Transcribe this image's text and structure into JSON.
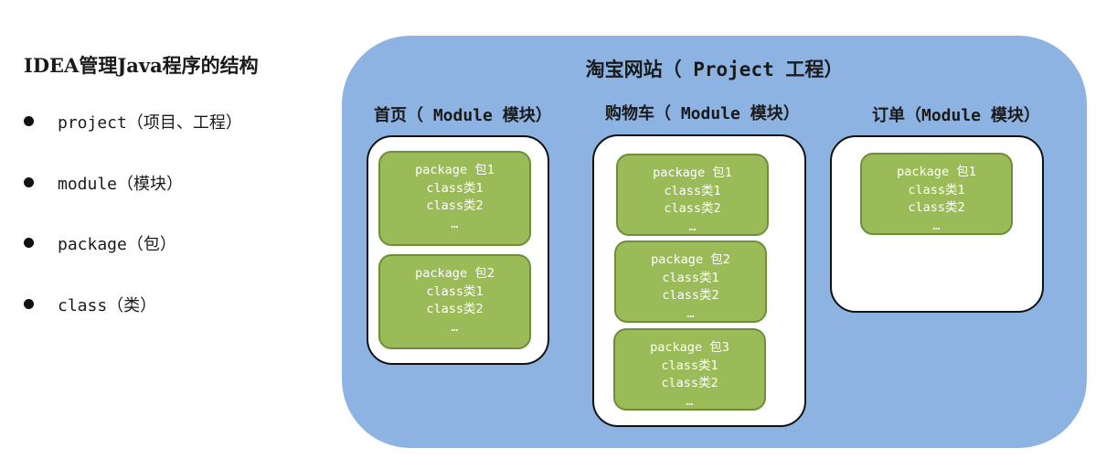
{
  "left": {
    "title": "IDEA管理Java程序的结构",
    "items": [
      {
        "label": "project（项目、工程）"
      },
      {
        "label": "module（模块）"
      },
      {
        "label": "package（包）"
      },
      {
        "label": "class（类）"
      }
    ]
  },
  "diagram": {
    "project_title": "淘宝网站（ Project 工程）",
    "modules": [
      {
        "title": "首页（ Module 模块）",
        "packages": [
          {
            "name": "package 包1",
            "classes": [
              "class类1",
              "class类2"
            ],
            "more": "…"
          },
          {
            "name": "package 包2",
            "classes": [
              "class类1",
              "class类2"
            ],
            "more": "…"
          }
        ]
      },
      {
        "title": "购物车（ Module 模块）",
        "packages": [
          {
            "name": "package 包1",
            "classes": [
              "class类1",
              "class类2"
            ],
            "more": "…"
          },
          {
            "name": "package 包2",
            "classes": [
              "class类1",
              "class类2"
            ],
            "more": "…"
          },
          {
            "name": "package 包3",
            "classes": [
              "class类1",
              "class类2"
            ],
            "more": "…"
          }
        ]
      },
      {
        "title": "订单（Module 模块）",
        "packages": [
          {
            "name": "package 包1",
            "classes": [
              "class类1",
              "class类2"
            ],
            "more": "…"
          }
        ]
      }
    ]
  },
  "colors": {
    "project_fill": "#8db3e2",
    "package_fill": "#9bbb59",
    "package_border": "#6e8f3a",
    "module_fill": "#ffffff"
  }
}
